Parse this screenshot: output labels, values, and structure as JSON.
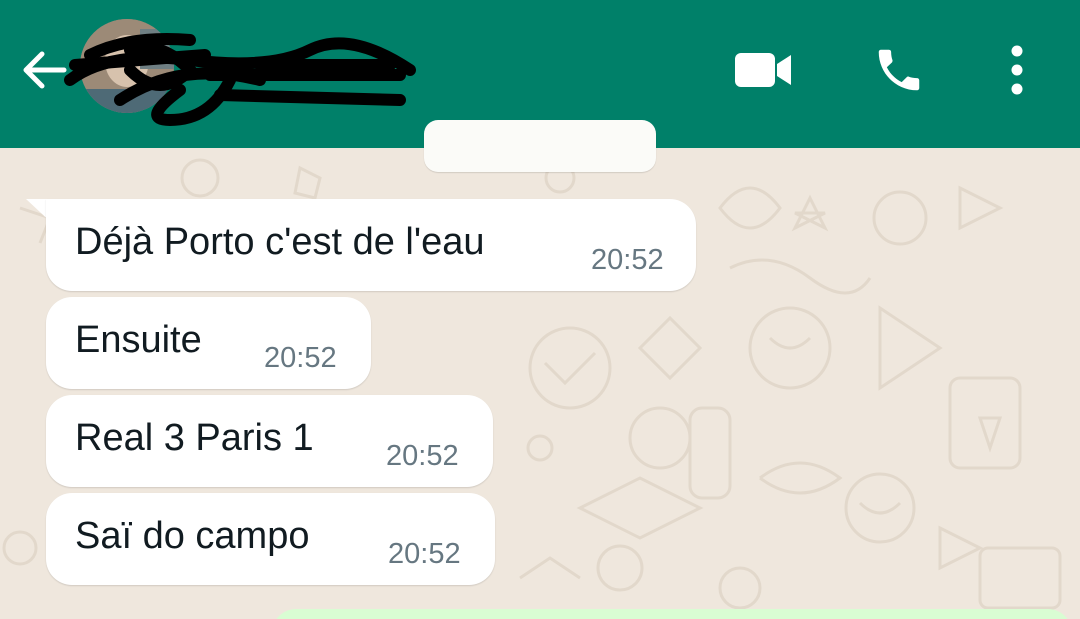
{
  "header": {
    "background_color": "#008069",
    "back_icon": "arrow-left-icon",
    "contact_name_redacted": true,
    "avatar": "contact-avatar",
    "actions": [
      {
        "icon": "video-camera-icon"
      },
      {
        "icon": "phone-icon"
      },
      {
        "icon": "more-vertical-icon"
      }
    ]
  },
  "chat": {
    "wallpaper_color": "#efe7dd",
    "date_chip": "",
    "messages": [
      {
        "text": "Déjà Porto c'est de l'eau",
        "time": "20:52"
      },
      {
        "text": "Ensuite",
        "time": "20:52"
      },
      {
        "text": "Real 3 Paris 1",
        "time": "20:52"
      },
      {
        "text": "Saï do campo",
        "time": "20:52"
      }
    ],
    "incoming_bubble_color": "#ffffff",
    "outgoing_bubble_color": "#d9fdd3"
  }
}
